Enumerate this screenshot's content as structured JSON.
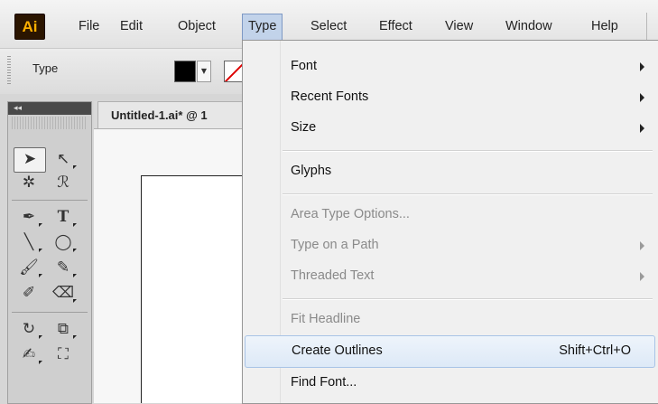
{
  "app": {
    "logo": "Ai"
  },
  "menubar": {
    "items": [
      {
        "label": "File"
      },
      {
        "label": "Edit"
      },
      {
        "label": "Object"
      },
      {
        "label": "Type"
      },
      {
        "label": "Select"
      },
      {
        "label": "Effect"
      },
      {
        "label": "View"
      },
      {
        "label": "Window"
      },
      {
        "label": "Help"
      }
    ],
    "active": "Type"
  },
  "controlbar": {
    "label": "Type",
    "fill_color": "#000000"
  },
  "document": {
    "tab_title": "Untitled-1.ai* @ 1"
  },
  "type_menu": {
    "items": [
      {
        "label": "Font",
        "submenu": true,
        "enabled": true
      },
      {
        "label": "Recent Fonts",
        "submenu": true,
        "enabled": true
      },
      {
        "label": "Size",
        "submenu": true,
        "enabled": true
      },
      {
        "label": "Glyphs",
        "submenu": false,
        "enabled": true
      },
      {
        "label": "Area Type Options...",
        "submenu": false,
        "enabled": false
      },
      {
        "label": "Type on a Path",
        "submenu": true,
        "enabled": false
      },
      {
        "label": "Threaded Text",
        "submenu": true,
        "enabled": false
      },
      {
        "label": "Fit Headline",
        "submenu": false,
        "enabled": false
      },
      {
        "label": "Create Outlines",
        "shortcut": "Shift+Ctrl+O",
        "submenu": false,
        "enabled": true,
        "highlighted": true
      },
      {
        "label": "Find Font...",
        "submenu": false,
        "enabled": true
      }
    ]
  },
  "tools": {
    "icons": [
      "selection-tool-icon",
      "direct-selection-tool-icon",
      "magic-wand-tool-icon",
      "lasso-tool-icon",
      "pen-tool-icon",
      "type-tool-icon",
      "line-segment-tool-icon",
      "ellipse-tool-icon",
      "paintbrush-tool-icon",
      "pencil-tool-icon",
      "blob-brush-tool-icon",
      "eraser-tool-icon",
      "rotate-tool-icon",
      "scale-tool-icon",
      "width-tool-icon",
      "free-transform-tool-icon"
    ]
  },
  "colors": {
    "menu_highlight": "#c2d3ea",
    "item_hover": "#dde9f7",
    "disabled_text": "#8a8a8a",
    "logo_bg": "#2b1500",
    "logo_fg": "#ffb000"
  }
}
